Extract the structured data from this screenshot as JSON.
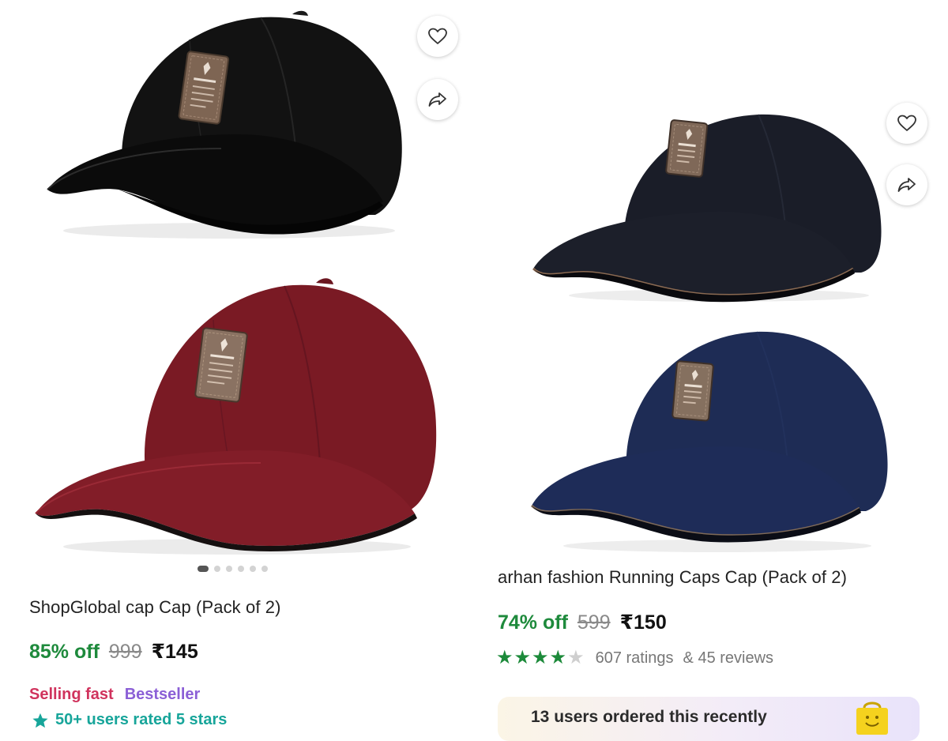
{
  "left_product": {
    "title": "ShopGlobal cap Cap (Pack of 2)",
    "discount": "85% off",
    "mrp": "999",
    "price": "₹145",
    "tag_selling": "Selling fast",
    "tag_bestseller": "Bestseller",
    "rated_text": "50+ users rated 5 stars",
    "image_count": 6,
    "active_image_index": 0,
    "cap_colors": [
      "#121212",
      "#7a1a24"
    ]
  },
  "right_product": {
    "title": "arhan fashion Running Caps Cap (Pack of 2)",
    "discount": "74% off",
    "mrp": "599",
    "price": "₹150",
    "rating_stars": 4,
    "ratings_text": "607 ratings",
    "reviews_text": "& 45 reviews",
    "banner_text": "13 users ordered this recently",
    "cap_colors": [
      "#1a1d28",
      "#1e2c55"
    ]
  },
  "icons": {
    "wishlist": "heart-icon",
    "share": "share-icon",
    "rated": "star-icon",
    "banner": "shopping-bag-icon"
  },
  "colors": {
    "discount_green": "#1e8a3c",
    "selling_fast": "#d0335d",
    "bestseller": "#8b5fd6",
    "rated_teal": "#17a59a",
    "star_green": "#1c8a3a"
  }
}
